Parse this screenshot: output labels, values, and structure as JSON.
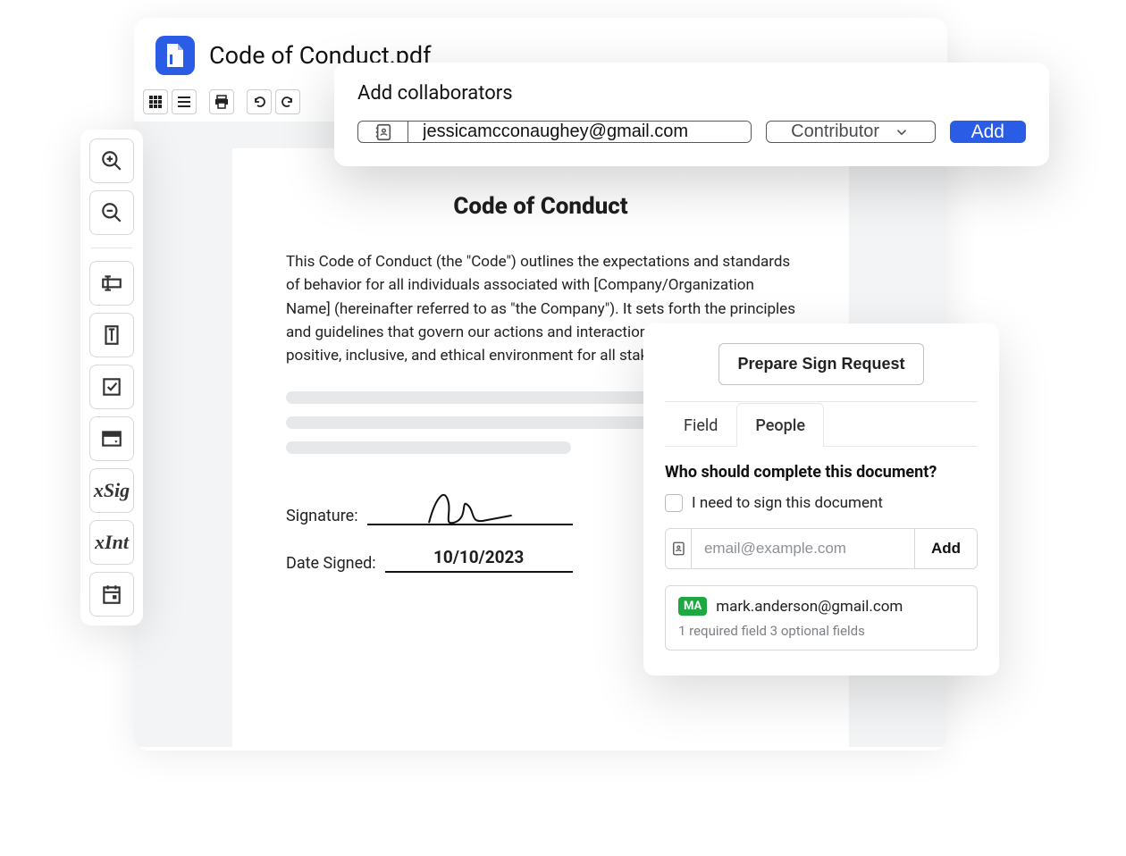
{
  "header": {
    "doc_title": "Code of Conduct.pdf"
  },
  "toolbar": {
    "grid": "grid-view",
    "outline": "outline-view",
    "print": "print",
    "undo": "undo",
    "redo": "redo"
  },
  "palette": {
    "zoom_in": "zoom-in",
    "zoom_out": "zoom-out",
    "text_field_h": "horizontal-text-field",
    "text_field_v": "vertical-text-field",
    "checkbox": "checkbox-field",
    "dropdown": "dropdown-field",
    "sig_label": "xSig",
    "int_label": "xInt",
    "date": "date-field"
  },
  "page": {
    "title": "Code of Conduct",
    "para": "This Code of Conduct (the \"Code\") outlines the expectations and standards of behavior for all individuals associated with [Company/Organization Name] (hereinafter referred to as \"the Company\"). It sets forth the principles and guidelines that govern our actions and interactions, promoting a positive, inclusive, and ethical environment for all stakeholders.",
    "signature_label": "Signature:",
    "date_label": "Date Signed:",
    "date_value": "10/10/2023"
  },
  "collab": {
    "title": "Add collaborators",
    "email_value": "jessicamcconaughey@gmail.com",
    "role": "Contributor",
    "add_label": "Add"
  },
  "sign_panel": {
    "prepare_label": "Prepare Sign Request",
    "tab_field": "Field",
    "tab_people": "People",
    "who_title": "Who should complete this document?",
    "self_sign_label": "I need to sign this document",
    "email_placeholder": "email@example.com",
    "add_label": "Add",
    "signer_badge": "MA",
    "signer_email": "mark.anderson@gmail.com",
    "signer_sub": "1 required field 3 optional fields"
  }
}
